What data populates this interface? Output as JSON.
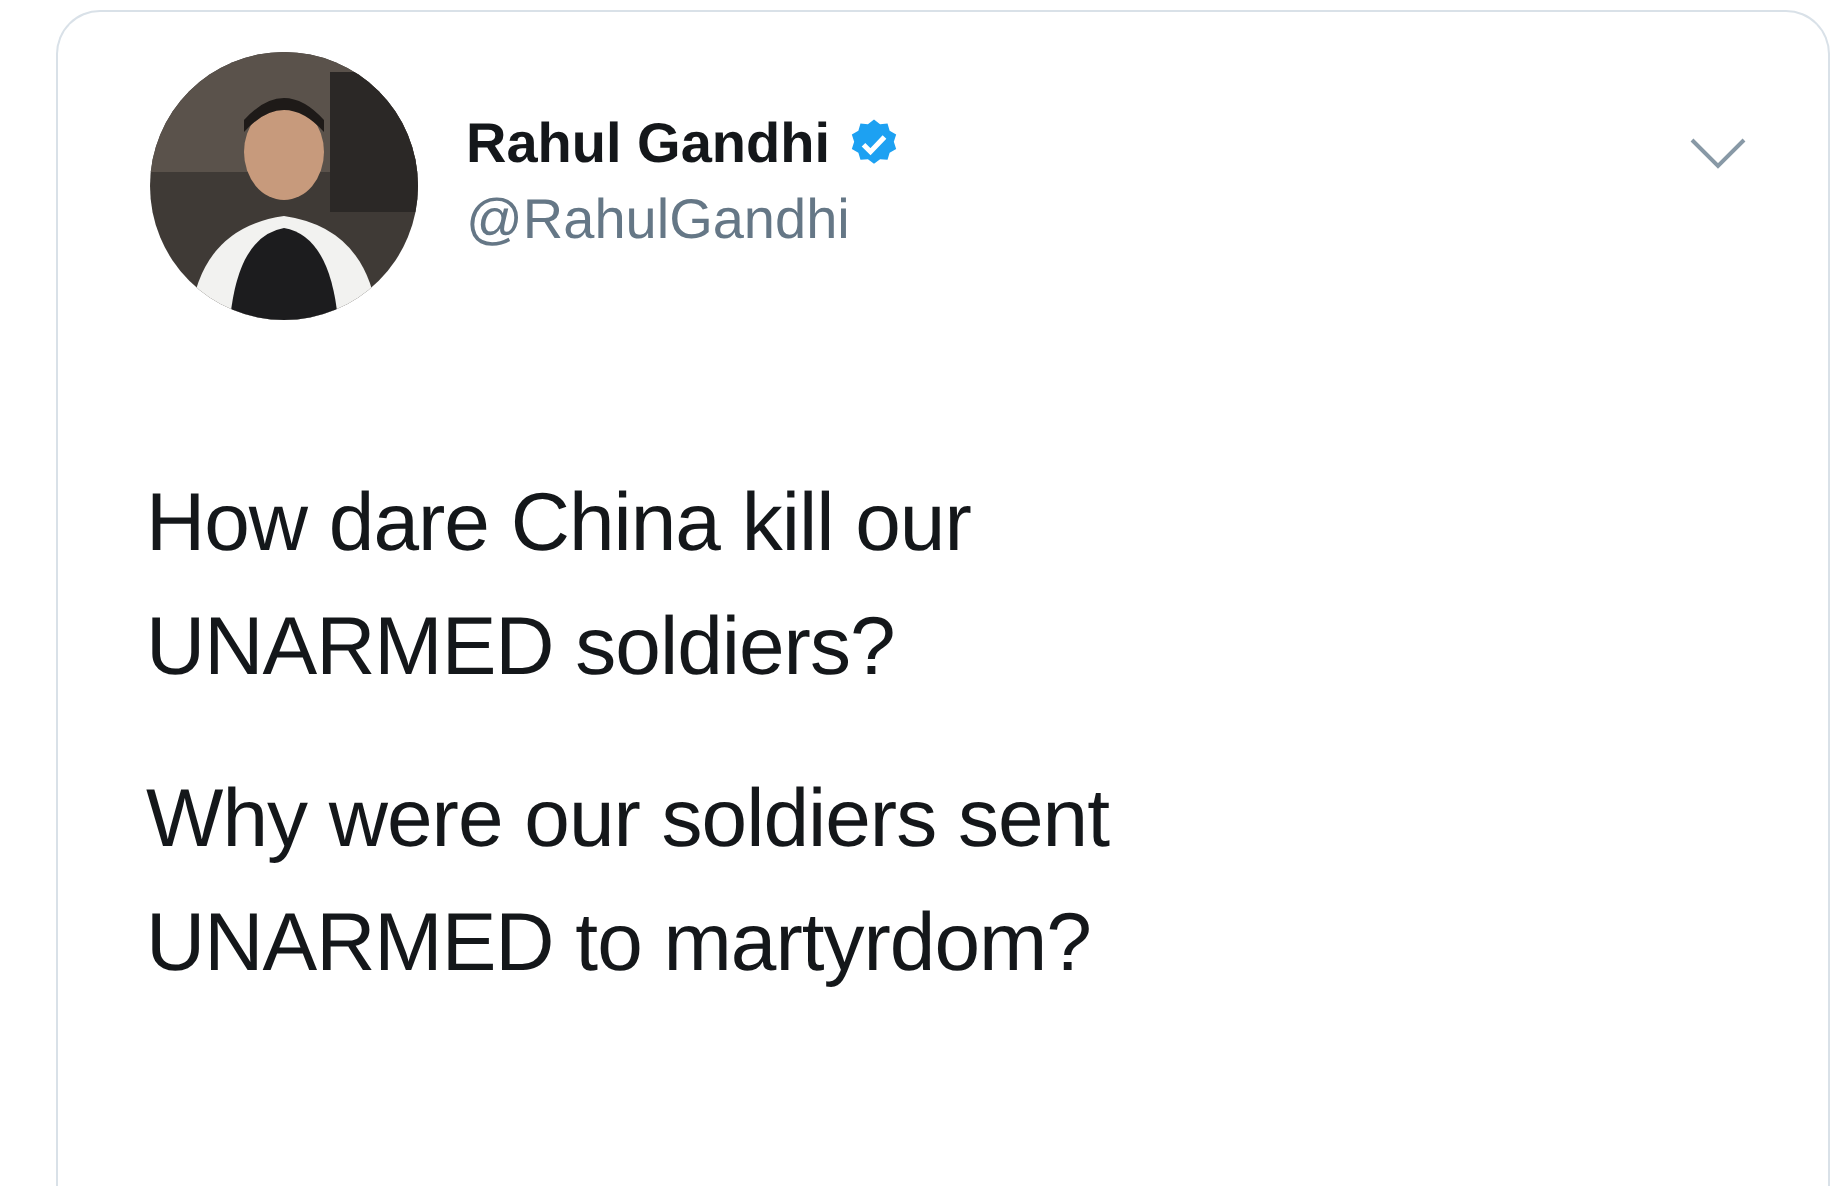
{
  "tweet": {
    "author": {
      "name": "Rahul Gandhi",
      "verified": true,
      "handle": "@RahulGandhi"
    },
    "paragraphs": [
      "How dare China kill our UNARMED soldiers?",
      "Why were our soldiers sent UNARMED to martyrdom?"
    ]
  }
}
